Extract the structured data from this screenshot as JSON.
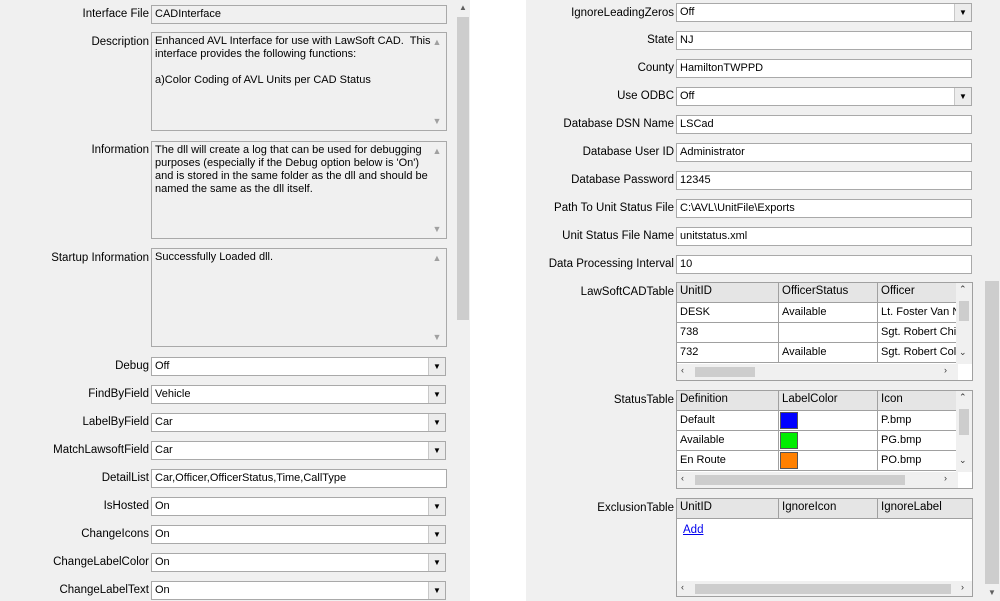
{
  "left": {
    "interface_file": {
      "label": "Interface File",
      "value": "CADInterface"
    },
    "description": {
      "label": "Description",
      "value": "Enhanced AVL Interface for use with LawSoft CAD.  This interface provides the following functions:\n\na)Color Coding of AVL Units per CAD Status"
    },
    "information": {
      "label": "Information",
      "value": "The dll will create a log that can be used for debugging purposes (especially if the Debug option below is 'On') and is stored in the same folder as the dll and should be named the same as the dll itself."
    },
    "startup": {
      "label": "Startup Information",
      "value": "Successfully Loaded dll."
    },
    "debug": {
      "label": "Debug",
      "value": "Off"
    },
    "find_by_field": {
      "label": "FindByField",
      "value": "Vehicle"
    },
    "label_by_field": {
      "label": "LabelByField",
      "value": "Car"
    },
    "match_lawsoft_field": {
      "label": "MatchLawsoftField",
      "value": "Car"
    },
    "detail_list": {
      "label": "DetailList",
      "value": "Car,Officer,OfficerStatus,Time,CallType"
    },
    "is_hosted": {
      "label": "IsHosted",
      "value": "On"
    },
    "change_icons": {
      "label": "ChangeIcons",
      "value": "On"
    },
    "change_label_color": {
      "label": "ChangeLabelColor",
      "value": "On"
    },
    "change_label_text": {
      "label": "ChangeLabelText",
      "value": "On"
    }
  },
  "right": {
    "ignore_leading_zeros": {
      "label": "IgnoreLeadingZeros",
      "value": "Off"
    },
    "state": {
      "label": "State",
      "value": "NJ"
    },
    "county": {
      "label": "County",
      "value": "HamiltonTWPPD"
    },
    "use_odbc": {
      "label": "Use ODBC",
      "value": "Off"
    },
    "dsn_name": {
      "label": "Database DSN Name",
      "value": "LSCad"
    },
    "user_id": {
      "label": "Database User ID",
      "value": "Administrator"
    },
    "password": {
      "label": "Database  Password",
      "value": "12345"
    },
    "path_unit_status": {
      "label": "Path To Unit Status  File",
      "value": "C:\\AVL\\UnitFile\\Exports"
    },
    "unit_status_file_name": {
      "label": "Unit Status File Name",
      "value": "unitstatus.xml"
    },
    "data_processing_interval": {
      "label": "Data Processing Interval",
      "value": "10"
    },
    "lawsoft_table": {
      "label": "LawSoftCADTable",
      "headers": [
        "UnitID",
        "OfficerStatus",
        "Officer"
      ],
      "rows": [
        [
          "DESK",
          "Available",
          "Lt. Foster Van N"
        ],
        [
          "738",
          "",
          "Sgt. Robert Chia"
        ],
        [
          "732",
          "Available",
          "Sgt. Robert Colle"
        ]
      ]
    },
    "status_table": {
      "label": "StatusTable",
      "headers": [
        "Definition",
        "LabelColor",
        "Icon"
      ],
      "rows": [
        {
          "definition": "Default",
          "color": "#0000ff",
          "icon": "P.bmp"
        },
        {
          "definition": "Available",
          "color": "#00ee00",
          "icon": "PG.bmp"
        },
        {
          "definition": "En Route",
          "color": "#ff8000",
          "icon": "PO.bmp"
        }
      ]
    },
    "exclusion_table": {
      "label": "ExclusionTable",
      "headers": [
        "UnitID",
        "IgnoreIcon",
        "IgnoreLabel"
      ],
      "add_link": "Add"
    }
  },
  "icons": {
    "dropdown": "chevron-down-icon",
    "scroll_up": "scroll-up-arrow-icon",
    "scroll_down": "scroll-down-arrow-icon",
    "scroll_left": "scroll-left-arrow-icon",
    "scroll_right": "scroll-right-arrow-icon"
  }
}
